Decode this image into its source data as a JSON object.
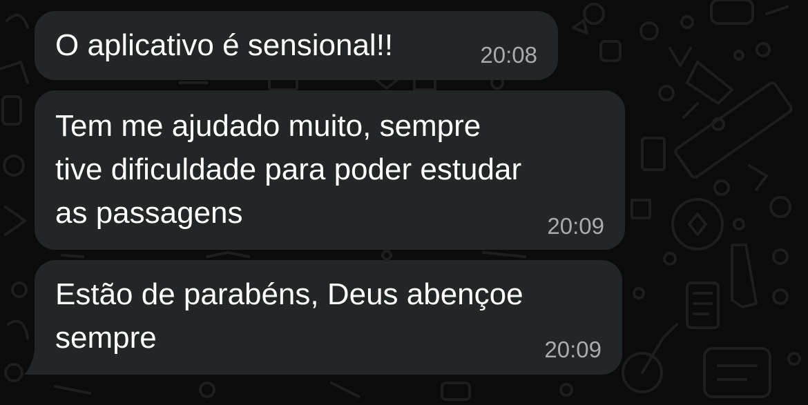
{
  "chat": {
    "messages": [
      {
        "lines": [
          "O aplicativo é sensional!!"
        ],
        "time": "20:08"
      },
      {
        "lines": [
          "Tem me ajudado muito, sempre",
          "tive dificuldade para poder estudar",
          "as passagens"
        ],
        "time": "20:09"
      },
      {
        "lines": [
          "Estão de parabéns, Deus abençoe",
          "sempre"
        ],
        "time": "20:09"
      }
    ]
  },
  "colors": {
    "background": "#0b0b0b",
    "bubble": "#232626",
    "message_text": "#ffffff",
    "timestamp_text": "#a9acad",
    "wallpaper_doodle": "#1c1c1c"
  }
}
